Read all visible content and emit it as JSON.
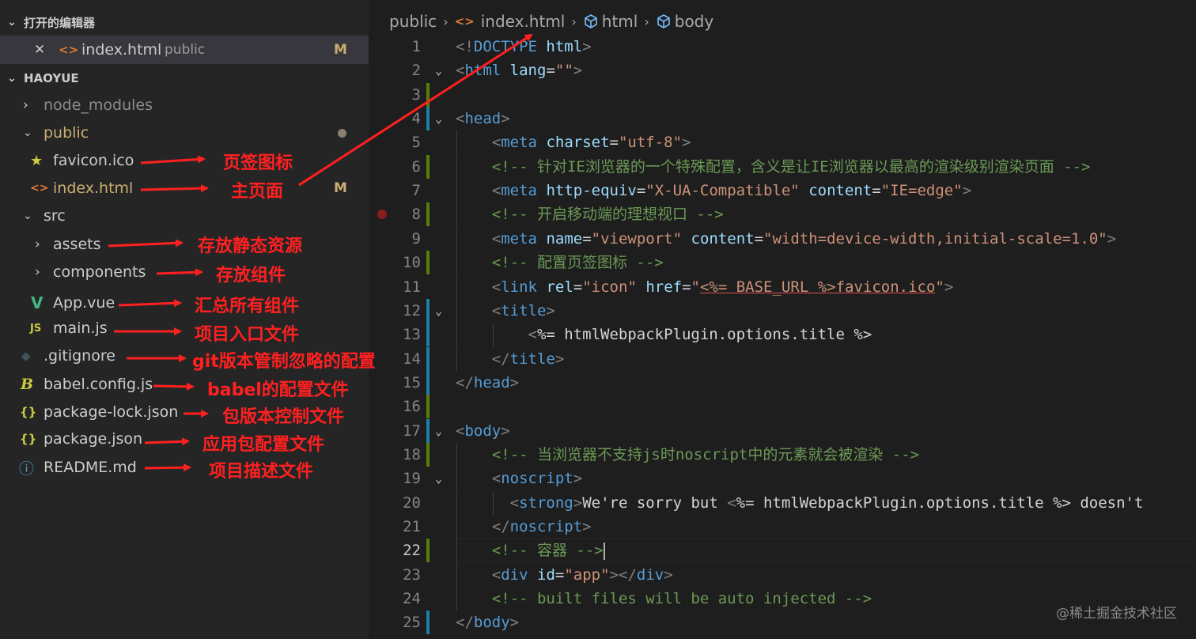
{
  "sidebar": {
    "open_editors_title": "打开的编辑器",
    "open_editor": {
      "close_glyph": "✕",
      "file": "index.html",
      "folder": "public",
      "status": "M"
    },
    "project_title": "HAOYUE",
    "tree": [
      {
        "name": "node_modules",
        "kind": "folder",
        "expanded": false
      },
      {
        "name": "public",
        "kind": "folder",
        "expanded": true
      },
      {
        "name": "favicon.ico",
        "kind": "file",
        "icon": "star-icon"
      },
      {
        "name": "index.html",
        "kind": "file",
        "icon": "html-icon",
        "status": "M"
      },
      {
        "name": "src",
        "kind": "folder",
        "expanded": true
      },
      {
        "name": "assets",
        "kind": "folder",
        "expanded": false
      },
      {
        "name": "components",
        "kind": "folder",
        "expanded": false
      },
      {
        "name": "App.vue",
        "kind": "file",
        "icon": "vue-icon"
      },
      {
        "name": "main.js",
        "kind": "file",
        "icon": "js-icon",
        "icon_text": "JS"
      },
      {
        "name": ".gitignore",
        "kind": "file",
        "icon": "git-icon"
      },
      {
        "name": "babel.config.js",
        "kind": "file",
        "icon": "babel-icon"
      },
      {
        "name": "package-lock.json",
        "kind": "file",
        "icon": "json-icon",
        "icon_text": "{}"
      },
      {
        "name": "package.json",
        "kind": "file",
        "icon": "json-icon",
        "icon_text": "{}"
      },
      {
        "name": "README.md",
        "kind": "file",
        "icon": "info-icon"
      }
    ]
  },
  "annotations": [
    "页签图标",
    "主页面",
    "存放静态资源",
    "存放组件",
    "汇总所有组件",
    "项目入口文件",
    "git版本管制忽略的配置",
    "babel的配置文件",
    "包版本控制文件",
    "应用包配置文件",
    "项目描述文件"
  ],
  "annotation_color": "#ff2020",
  "breadcrumb": [
    "public",
    "index.html",
    "html",
    "body"
  ],
  "editor": {
    "active_line": 22,
    "lines": [
      {
        "n": "1",
        "text": "<!DOCTYPE html>"
      },
      {
        "n": "2",
        "text": "<html lang=\"\">"
      },
      {
        "n": "3",
        "text": ""
      },
      {
        "n": "4",
        "text": "<head>"
      },
      {
        "n": "5",
        "text": "    <meta charset=\"utf-8\">"
      },
      {
        "n": "6",
        "text": "    <!-- 针对IE浏览器的一个特殊配置，含义是让IE浏览器以最高的渲染级别渲染页面 -->"
      },
      {
        "n": "7",
        "text": "    <meta http-equiv=\"X-UA-Compatible\" content=\"IE=edge\">"
      },
      {
        "n": "8",
        "text": "    <!-- 开启移动端的理想视口 -->"
      },
      {
        "n": "9",
        "text": "    <meta name=\"viewport\" content=\"width=device-width,initial-scale=1.0\">"
      },
      {
        "n": "10",
        "text": "    <!-- 配置页签图标 -->"
      },
      {
        "n": "11",
        "text": "    <link rel=\"icon\" href=\"<%= BASE_URL %>favicon.ico\">"
      },
      {
        "n": "12",
        "text": "    <title>"
      },
      {
        "n": "13",
        "text": "        <%= htmlWebpackPlugin.options.title %>"
      },
      {
        "n": "14",
        "text": "    </title>"
      },
      {
        "n": "15",
        "text": "</head>"
      },
      {
        "n": "16",
        "text": ""
      },
      {
        "n": "17",
        "text": "<body>"
      },
      {
        "n": "18",
        "text": "    <!-- 当浏览器不支持js时noscript中的元素就会被渲染 -->"
      },
      {
        "n": "19",
        "text": "    <noscript>"
      },
      {
        "n": "20",
        "text": "      <strong>We're sorry but <%= htmlWebpackPlugin.options.title %> doesn't"
      },
      {
        "n": "21",
        "text": "    </noscript>"
      },
      {
        "n": "22",
        "text": "    <!-- 容器 -->"
      },
      {
        "n": "23",
        "text": "    <div id=\"app\"></div>"
      },
      {
        "n": "24",
        "text": "    <!-- built files will be auto injected -->"
      },
      {
        "n": "25",
        "text": "</body>"
      }
    ]
  },
  "watermark": "@稀土掘金技术社区",
  "colors": {
    "sidebar_bg": "#252526",
    "editor_bg": "#1e1e1e",
    "selected_row": "#37373d",
    "modified": "#c9ae71",
    "tag": "#569cd6",
    "attr": "#9cdcfe",
    "string": "#ce9178",
    "comment": "#6a9955",
    "gutter_added": "#587c0c",
    "gutter_modified": "#1b81a8"
  }
}
